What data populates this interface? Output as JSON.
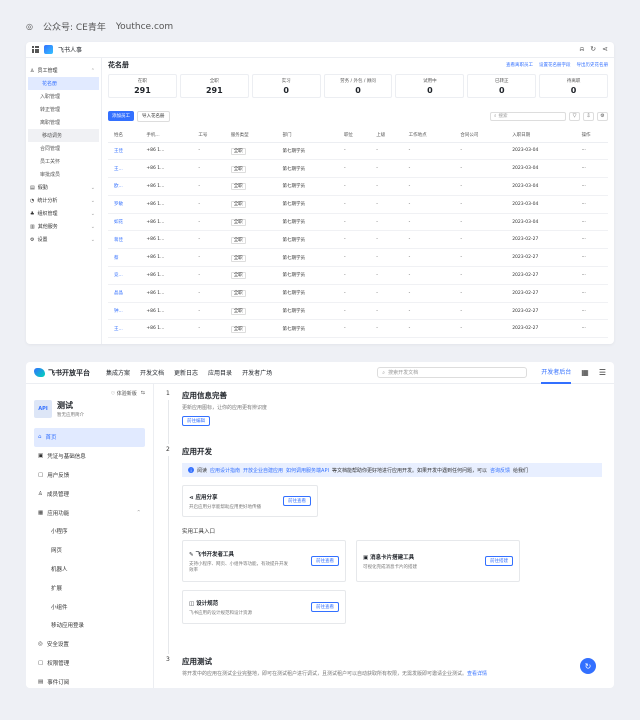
{
  "watermark": {
    "account": "公众号: CE青年",
    "site": "Youthce.com"
  },
  "top": {
    "title": "飞书人事",
    "sidebar": [
      {
        "label": "员工管理",
        "type": "group",
        "icon": "user-icon"
      },
      {
        "label": "花名册",
        "type": "sub",
        "active": true
      },
      {
        "label": "入职管理",
        "type": "sub"
      },
      {
        "label": "转正管理",
        "type": "sub"
      },
      {
        "label": "离职管理",
        "type": "sub"
      },
      {
        "label": "移动调务",
        "type": "sub",
        "hl": true
      },
      {
        "label": "合同管理",
        "type": "sub"
      },
      {
        "label": "员工关怀",
        "type": "sub"
      },
      {
        "label": "审批成员",
        "type": "sub"
      },
      {
        "label": "假勤",
        "type": "group",
        "icon": "calendar-icon"
      },
      {
        "label": "统计分析",
        "type": "group",
        "icon": "chart-icon"
      },
      {
        "label": "组织管理",
        "type": "group",
        "icon": "org-icon"
      },
      {
        "label": "其他服务",
        "type": "group",
        "icon": "service-icon"
      },
      {
        "label": "设置",
        "type": "group",
        "icon": "gear-icon"
      }
    ],
    "page_title": "花名册",
    "header_links": [
      "查看离职员工",
      "设置花名册字段",
      "导出历史花名册"
    ],
    "stats": [
      {
        "label": "在职",
        "value": "291"
      },
      {
        "label": "全职",
        "value": "291"
      },
      {
        "label": "实习",
        "value": "0"
      },
      {
        "label": "劳务 / 外包 / 顾问",
        "value": "0"
      },
      {
        "label": "试用中",
        "value": "0"
      },
      {
        "label": "已转正",
        "value": "0"
      },
      {
        "label": "待离职",
        "value": "0"
      }
    ],
    "add_button": "添加员工",
    "import_button": "导入花名册",
    "search_placeholder": "搜索",
    "columns": [
      "姓名",
      "手机...",
      "工号",
      "服务类型",
      "部门",
      "职位",
      "上级",
      "工作地点",
      "合同公司",
      "入职日期",
      "操作"
    ],
    "rows": [
      {
        "name": "王佳",
        "phone": "+86 1...",
        "type": "全职",
        "dept": "第七期学员",
        "date": "2023-03-04"
      },
      {
        "name": "王...",
        "phone": "+86 1...",
        "type": "全职",
        "dept": "第七期学员",
        "date": "2023-03-04"
      },
      {
        "name": "欧...",
        "phone": "+86 1...",
        "type": "全职",
        "dept": "第七期学员",
        "date": "2023-03-04"
      },
      {
        "name": "罗敏",
        "phone": "+86 1...",
        "type": "全职",
        "dept": "第七期学员",
        "date": "2023-03-04"
      },
      {
        "name": "如花",
        "phone": "+86 1...",
        "type": "全职",
        "dept": "第七期学员",
        "date": "2023-03-04"
      },
      {
        "name": "蒋佳",
        "phone": "+86 1...",
        "type": "全职",
        "dept": "第七期学员",
        "date": "2023-02-27"
      },
      {
        "name": "蔡",
        "phone": "+86 1...",
        "type": "全职",
        "dept": "第七期学员",
        "date": "2023-02-27"
      },
      {
        "name": "竞...",
        "phone": "+86 1...",
        "type": "全职",
        "dept": "第七期学员",
        "date": "2023-02-27"
      },
      {
        "name": "晶晶",
        "phone": "+86 1...",
        "type": "全职",
        "dept": "第七期学员",
        "date": "2023-02-27"
      },
      {
        "name": "钟...",
        "phone": "+86 1...",
        "type": "全职",
        "dept": "第七期学员",
        "date": "2023-02-27"
      },
      {
        "name": "王...",
        "phone": "+86 1...",
        "type": "全职",
        "dept": "第七期学员",
        "date": "2023-02-27"
      }
    ],
    "dash": "-",
    "more": "···"
  },
  "bottom": {
    "brand": "飞书开放平台",
    "nav": [
      "集成方案",
      "开发文档",
      "更新日志",
      "应用目录",
      "开发者广场"
    ],
    "search_placeholder": "搜索开发文档",
    "dev_tab": "开发者后台",
    "back_label": "♡ 体验新版",
    "app_badge": "API",
    "app_name": "测试",
    "app_desc": "暂无应用简介",
    "menu": [
      {
        "label": "首页",
        "icon": "home-icon",
        "active": true
      },
      {
        "label": "凭证与基础信息",
        "icon": "key-icon"
      },
      {
        "label": "用户反馈",
        "icon": "feedback-icon"
      },
      {
        "label": "成员管理",
        "icon": "member-icon"
      },
      {
        "label": "应用功能",
        "icon": "feature-icon",
        "chevron": true
      },
      {
        "label": "小程序",
        "sub": true
      },
      {
        "label": "网页",
        "sub": true
      },
      {
        "label": "机器人",
        "sub": true
      },
      {
        "label": "扩展",
        "sub": true
      },
      {
        "label": "小组件",
        "sub": true
      },
      {
        "label": "移动应用登录",
        "sub": true
      },
      {
        "label": "安全设置",
        "icon": "shield-icon"
      },
      {
        "label": "权限管理",
        "icon": "lock-icon"
      },
      {
        "label": "事件订阅",
        "icon": "event-icon"
      }
    ],
    "step1": {
      "num": "1",
      "title": "应用信息完善",
      "desc": "更新应用图标，让你的应用更有辨识度",
      "button": "前往编辑"
    },
    "step2": {
      "num": "2",
      "title": "应用开发",
      "info_prefix": "阅读",
      "info_link1": "应用设计指南",
      "info_link2": "开放企业自建应用",
      "info_link3": "如何调用服务端API",
      "info_mid": "等文档能帮助你更好地进行应用开发。如果开发中遇到任何问题，可以",
      "info_link4": "咨询反馈",
      "info_suffix": "给我们",
      "share_title": "应用分享",
      "share_desc": "开启应用分享能帮助应用更好地传播",
      "share_button": "前往查看",
      "tools_label": "实用工具入口",
      "tool1_title": "飞书开发者工具",
      "tool1_desc": "支持小程序、网页、小组件等功能，有效提升开发效率",
      "tool1_button": "前往查看",
      "tool2_title": "消息卡片搭建工具",
      "tool2_desc": "可视化完成消息卡片的搭建",
      "tool2_button": "前往搭建",
      "tool3_title": "设计规范",
      "tool3_desc": "飞书应用的设计规范和设计资源",
      "tool3_button": "前往查看"
    },
    "step3": {
      "num": "3",
      "title": "应用测试",
      "desc": "将开发中的应用在测试企业完整地，即可在测试租户进行调试，且测试租户可以自动获取所有权限，无需发版即可邀请企业测试。",
      "link": "查看详情"
    }
  }
}
